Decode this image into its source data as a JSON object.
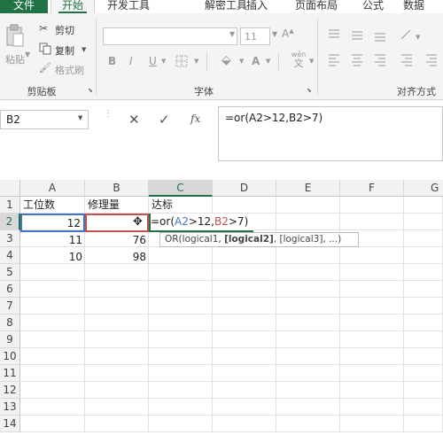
{
  "tabs": {
    "file": "文件",
    "home": "开始",
    "developer": "开发工具",
    "decrypt": "解密工具",
    "insert": "插入",
    "page_layout": "页面布局",
    "formulas": "公式",
    "data": "数据"
  },
  "ribbon": {
    "clipboard": {
      "paste": "粘贴",
      "cut": "剪切",
      "copy": "复制",
      "format_painter": "格式刷",
      "group_label": "剪贴板"
    },
    "font": {
      "size": "11",
      "bold": "B",
      "italic": "I",
      "underline": "U",
      "wen": "wén",
      "wen_char": "文",
      "group_label": "字体"
    },
    "alignment": {
      "group_label": "对齐方式"
    }
  },
  "formula_bar": {
    "name_box": "B2",
    "fx": "fx",
    "formula": "=or(A2>12,B2>7)"
  },
  "grid": {
    "columns": [
      "A",
      "B",
      "C",
      "D",
      "E",
      "F",
      "G"
    ],
    "rows": [
      "1",
      "2",
      "3",
      "4",
      "5",
      "6",
      "7",
      "8",
      "9",
      "10",
      "11",
      "12",
      "13",
      "14"
    ],
    "cells": {
      "A1": "工位数",
      "B1": "修理量",
      "C1": "达标",
      "A2": "12",
      "A3": "11",
      "B3": "76",
      "A4": "10",
      "B4": "98"
    },
    "editing_formula": {
      "prefix": "=or(",
      "ref1": "A2",
      "mid": ">12,",
      "ref2": "B2",
      "suffix": ">7)"
    },
    "tooltip": {
      "fn": "OR(logical1, ",
      "bold": "[logical2]",
      "rest": ", [logical3], ...)"
    }
  },
  "colors": {
    "accent": "#217346",
    "ref_a2": "#4472c4",
    "ref_b2": "#c0504d"
  }
}
